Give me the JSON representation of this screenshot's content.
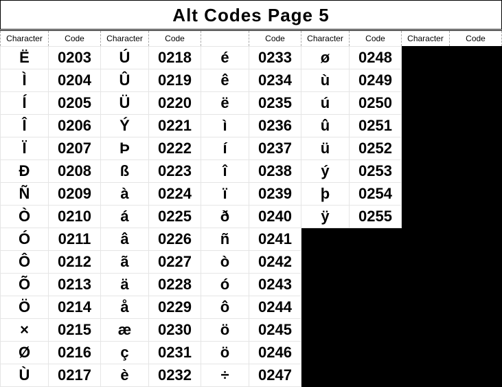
{
  "title": "Alt Codes Page 5",
  "headers": {
    "character": "Character",
    "code": "Code"
  },
  "columns": 5,
  "rows_per_column": 15,
  "cols": [
    [
      {
        "char": "Ë",
        "code": "0203"
      },
      {
        "char": "Ì",
        "code": "0204"
      },
      {
        "char": "Í",
        "code": "0205"
      },
      {
        "char": "Î",
        "code": "0206"
      },
      {
        "char": "Ï",
        "code": "0207"
      },
      {
        "char": "Ð",
        "code": "0208"
      },
      {
        "char": "Ñ",
        "code": "0209"
      },
      {
        "char": "Ò",
        "code": "0210"
      },
      {
        "char": "Ó",
        "code": "0211"
      },
      {
        "char": "Ô",
        "code": "0212"
      },
      {
        "char": "Õ",
        "code": "0213"
      },
      {
        "char": "Ö",
        "code": "0214"
      },
      {
        "char": "×",
        "code": "0215"
      },
      {
        "char": "Ø",
        "code": "0216"
      },
      {
        "char": "Ù",
        "code": "0217"
      }
    ],
    [
      {
        "char": "Ú",
        "code": "0218"
      },
      {
        "char": "Û",
        "code": "0219"
      },
      {
        "char": "Ü",
        "code": "0220"
      },
      {
        "char": "Ý",
        "code": "0221"
      },
      {
        "char": "Þ",
        "code": "0222"
      },
      {
        "char": "ß",
        "code": "0223"
      },
      {
        "char": "à",
        "code": "0224"
      },
      {
        "char": "á",
        "code": "0225"
      },
      {
        "char": "â",
        "code": "0226"
      },
      {
        "char": "ã",
        "code": "0227"
      },
      {
        "char": "ä",
        "code": "0228"
      },
      {
        "char": "å",
        "code": "0229"
      },
      {
        "char": "æ",
        "code": "0230"
      },
      {
        "char": "ç",
        "code": "0231"
      },
      {
        "char": "è",
        "code": "0232"
      }
    ],
    [
      {
        "char": "é",
        "code": "0233"
      },
      {
        "char": "ê",
        "code": "0234"
      },
      {
        "char": "ë",
        "code": "0235"
      },
      {
        "char": "ì",
        "code": "0236"
      },
      {
        "char": "í",
        "code": "0237"
      },
      {
        "char": "î",
        "code": "0238"
      },
      {
        "char": "ï",
        "code": "0239"
      },
      {
        "char": "ð",
        "code": "0240"
      },
      {
        "char": "ñ",
        "code": "0241"
      },
      {
        "char": "ò",
        "code": "0242"
      },
      {
        "char": "ó",
        "code": "0243"
      },
      {
        "char": "ô",
        "code": "0244"
      },
      {
        "char": "ö",
        "code": "0245"
      },
      {
        "char": "ö",
        "code": "0246"
      },
      {
        "char": "÷",
        "code": "0247"
      }
    ],
    [
      {
        "char": "ø",
        "code": "0248"
      },
      {
        "char": "ù",
        "code": "0249"
      },
      {
        "char": "ú",
        "code": "0250"
      },
      {
        "char": "û",
        "code": "0251"
      },
      {
        "char": "ü",
        "code": "0252"
      },
      {
        "char": "ý",
        "code": "0253"
      },
      {
        "char": "þ",
        "code": "0254"
      },
      {
        "char": "ÿ",
        "code": "0255"
      }
    ],
    []
  ]
}
